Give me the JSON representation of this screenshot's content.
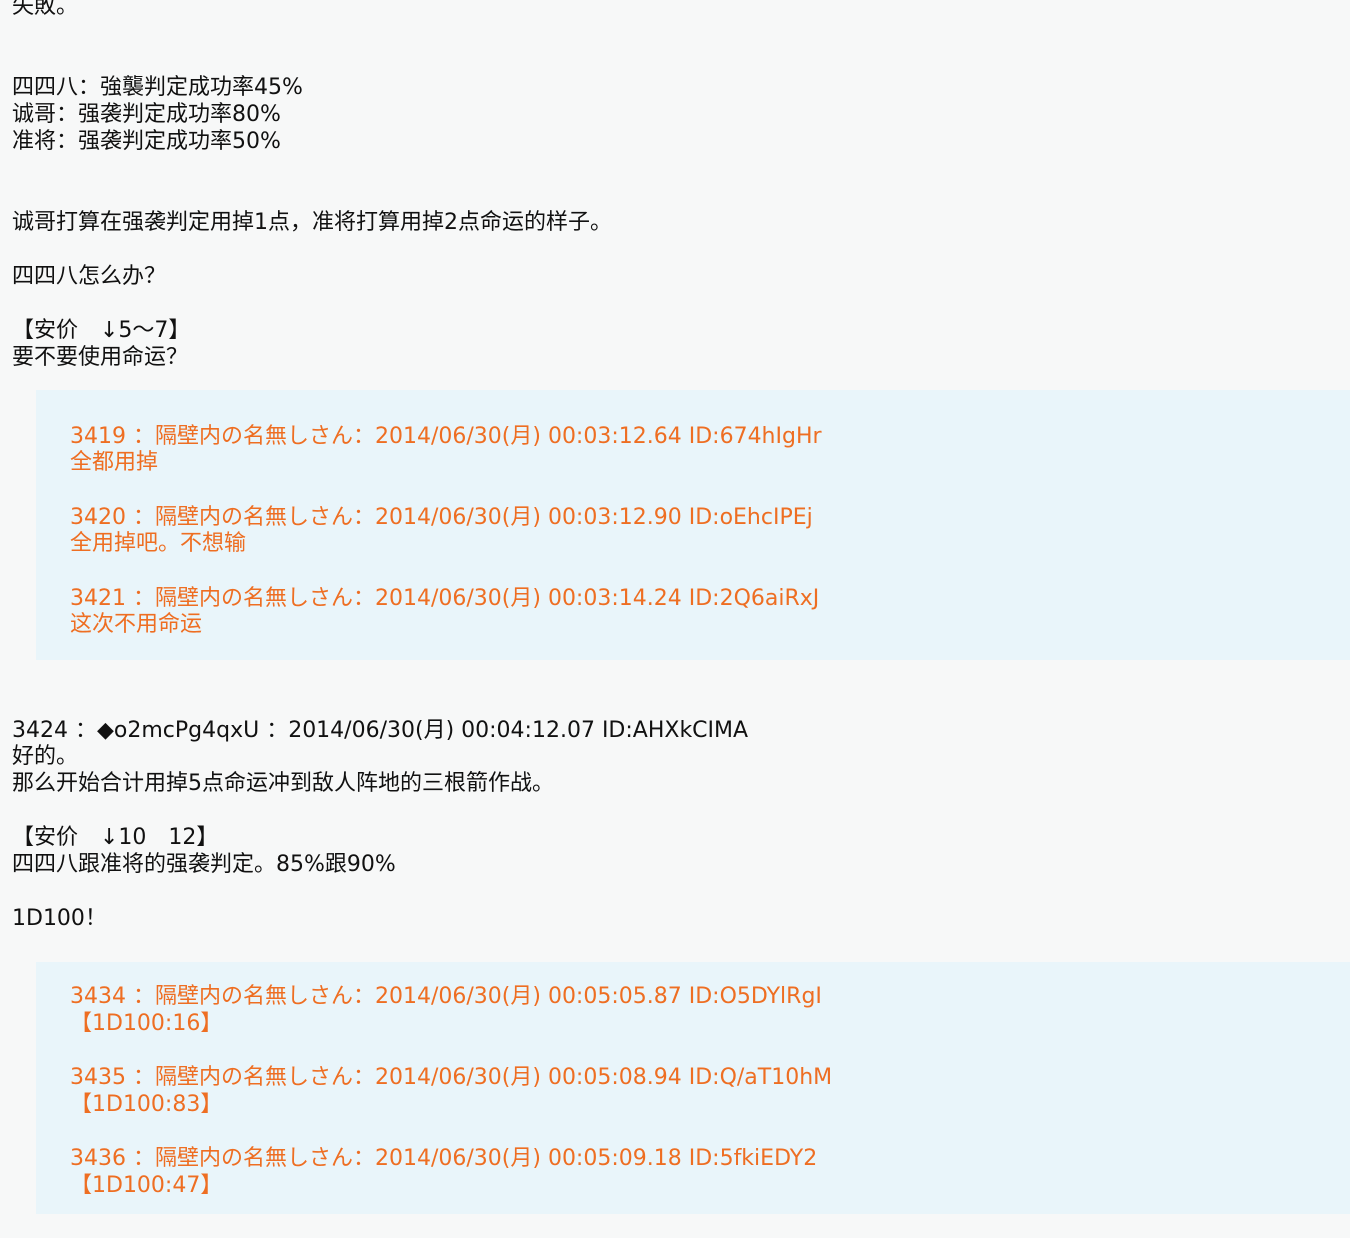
{
  "main": {
    "lines": [
      "失敗。",
      "四四八：強襲判定成功率45%",
      "诚哥：强袭判定成功率80%",
      "准将：强袭判定成功率50%",
      "诚哥打算在强袭判定用掉1点，准将打算用掉2点命运的样子。",
      "四四八怎么办？",
      "【安价　↓5～7】",
      "要不要使用命运？"
    ]
  },
  "quotes1": {
    "items": [
      {
        "header": "3419 ：隔壁内の名無しさん：2014/06/30(月) 00:03:12.64 ID:674hIgHr",
        "body": "全都用掉"
      },
      {
        "header": "3420 ：隔壁内の名無しさん：2014/06/30(月) 00:03:12.90 ID:oEhcIPEj",
        "body": "全用掉吧。不想输"
      },
      {
        "header": "3421 ：隔壁内の名無しさん：2014/06/30(月) 00:03:14.24 ID:2Q6aiRxJ",
        "body": "这次不用命运"
      }
    ]
  },
  "post": {
    "header": "3424 ：◆o2mcPg4qxU ：2014/06/30(月) 00:04:12.07 ID:AHXkCIMA",
    "lines": [
      "好的。",
      "那么开始合计用掉5点命运冲到敌人阵地的三根箭作战。",
      "【安价　↓10　12】",
      "四四八跟准将的强袭判定。85%跟90%",
      "1D100！"
    ]
  },
  "quotes2": {
    "items": [
      {
        "header": "3434 ：隔壁内の名無しさん：2014/06/30(月) 00:05:05.87 ID:O5DYlRgI",
        "body": "【1D100:16】"
      },
      {
        "header": "3435 ：隔壁内の名無しさん：2014/06/30(月) 00:05:08.94 ID:Q/aT10hM",
        "body": "【1D100:83】"
      },
      {
        "header": "3436 ：隔壁内の名無しさん：2014/06/30(月) 00:05:09.18 ID:5fkiEDY2",
        "body": "【1D100:47】"
      }
    ]
  }
}
